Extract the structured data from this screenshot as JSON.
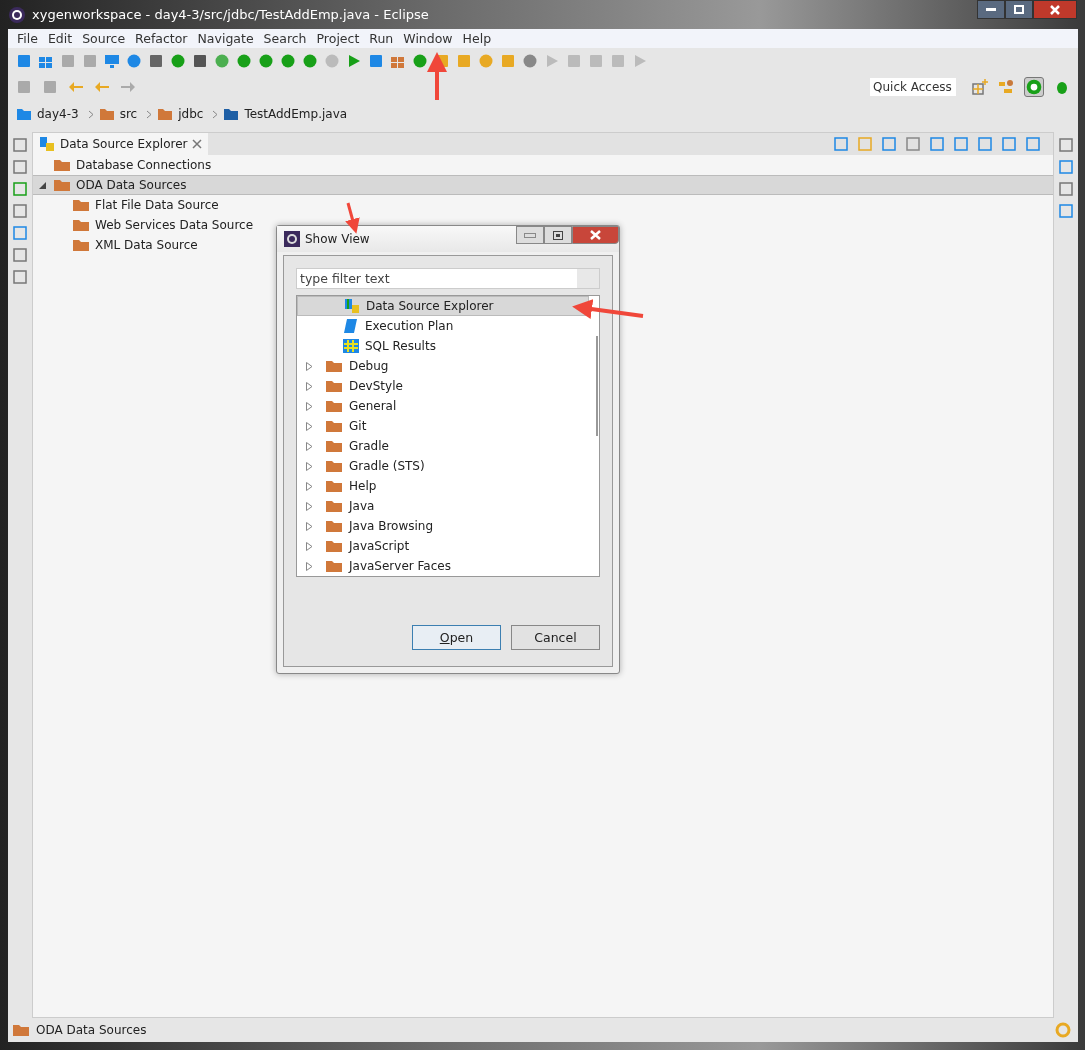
{
  "window": {
    "title": "xygenworkspace - day4-3/src/jdbc/TestAddEmp.java - Eclipse"
  },
  "menu": [
    "File",
    "Edit",
    "Source",
    "Refactor",
    "Navigate",
    "Search",
    "Project",
    "Run",
    "Window",
    "Help"
  ],
  "quick_access": {
    "placeholder": "Quick Access"
  },
  "breadcrumb": [
    "day4-3",
    "src",
    "jdbc",
    "TestAddEmp.java"
  ],
  "view_tab": {
    "label": "Data Source Explorer",
    "selected": true
  },
  "tree": [
    {
      "label": "Database Connections",
      "selected": false
    },
    {
      "label": "ODA Data Sources",
      "selected": true,
      "expanded": true,
      "children": [
        {
          "label": "Flat File Data Source",
          "selected": false
        },
        {
          "label": "Web Services Data Source",
          "selected": false
        },
        {
          "label": "XML Data Source",
          "selected": false
        }
      ]
    }
  ],
  "dialog": {
    "title": "Show View",
    "filter": {
      "placeholder": "type filter text"
    },
    "items": [
      {
        "label": "Data Source Explorer",
        "kind": "view",
        "selected": true
      },
      {
        "label": "Execution Plan",
        "kind": "view",
        "selected": false
      },
      {
        "label": "SQL Results",
        "kind": "view",
        "selected": false
      },
      {
        "label": "Debug",
        "kind": "category",
        "selected": false
      },
      {
        "label": "DevStyle",
        "kind": "category",
        "selected": false
      },
      {
        "label": "General",
        "kind": "category",
        "selected": false
      },
      {
        "label": "Git",
        "kind": "category",
        "selected": false
      },
      {
        "label": "Gradle",
        "kind": "category",
        "selected": false
      },
      {
        "label": "Gradle (STS)",
        "kind": "category",
        "selected": false
      },
      {
        "label": "Help",
        "kind": "category",
        "selected": false
      },
      {
        "label": "Java",
        "kind": "category",
        "selected": false
      },
      {
        "label": "Java Browsing",
        "kind": "category",
        "selected": false
      },
      {
        "label": "JavaScript",
        "kind": "category",
        "selected": false
      },
      {
        "label": "JavaServer Faces",
        "kind": "category",
        "selected": false
      }
    ],
    "buttons": [
      {
        "label": "Open",
        "default": true
      },
      {
        "label": "Cancel",
        "default": false
      }
    ]
  },
  "status_bar": {
    "text": "ODA Data Sources"
  }
}
